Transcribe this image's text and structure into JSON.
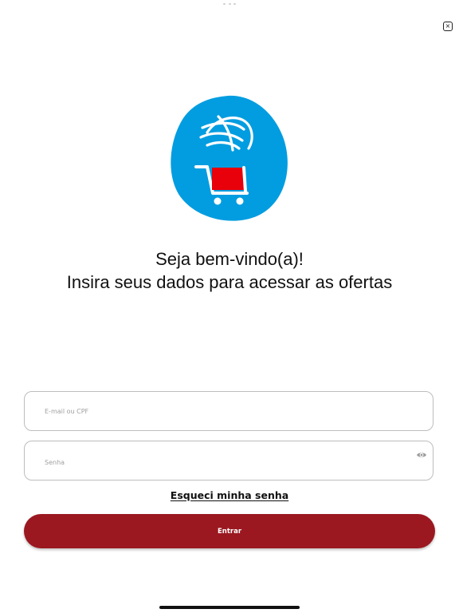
{
  "welcome": {
    "line1": "Seja bem-vindo(a)!",
    "line2": "Insira seus dados para acessar as ofertas"
  },
  "form": {
    "email_placeholder": "E-mail ou CPF",
    "password_placeholder": "Senha",
    "forgot_label": "Esqueci minha senha",
    "submit_label": "Entrar"
  },
  "icons": {
    "close": "close-icon",
    "password_visibility": "eye-icon",
    "logo": "shopping-cart-globe-logo"
  },
  "colors": {
    "logo_blue": "#029de0",
    "cart_red": "#e8000a",
    "button_red": "#9b1820",
    "text": "#111111",
    "border": "#bdbdbd"
  }
}
